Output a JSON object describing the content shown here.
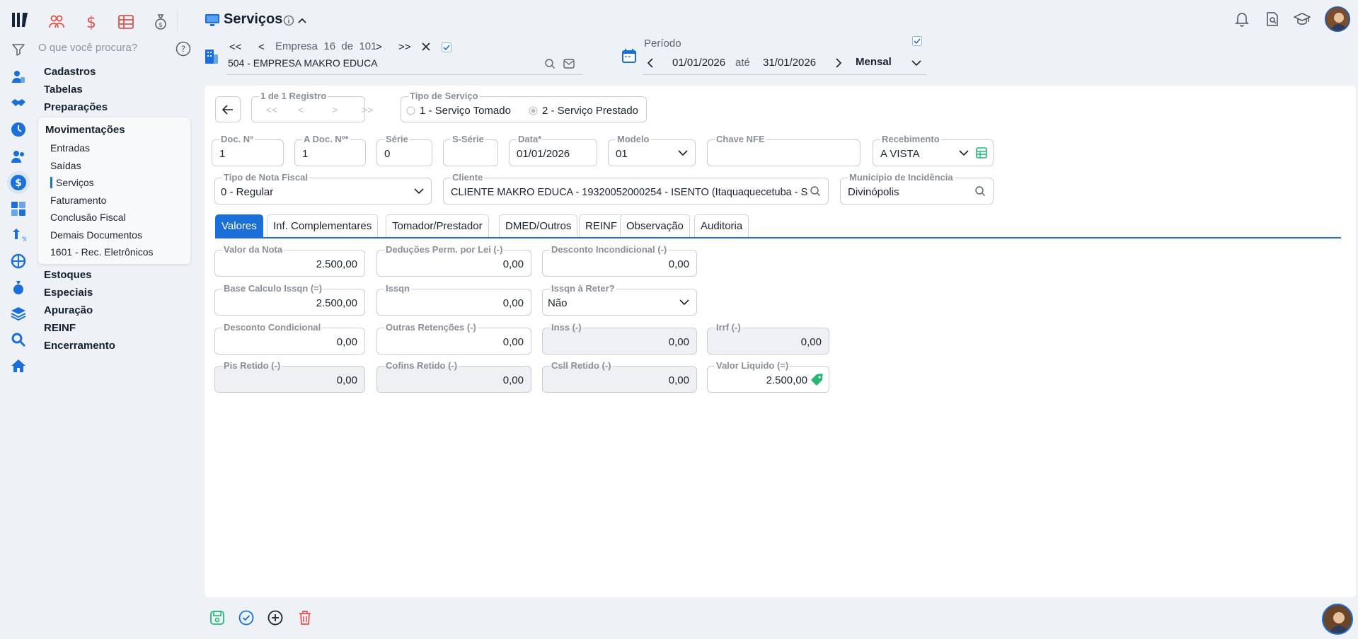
{
  "header": {
    "title": "Serviços",
    "empresa_nav_label": "Empresa",
    "empresa_index": "16",
    "empresa_de": "de",
    "empresa_total": "101",
    "empresa_value": "504 - EMPRESA MAKRO EDUCA",
    "periodo_label": "Período",
    "periodo_start": "01/01/2026",
    "periodo_ate": "até",
    "periodo_end": "31/01/2026",
    "periodo_type": "Mensal"
  },
  "search": {
    "placeholder": "O que você procura?"
  },
  "sidebar": {
    "top_items": [
      "Cadastros",
      "Tabelas",
      "Preparações"
    ],
    "submenu_title": "Movimentações",
    "submenu_items": [
      "Entradas",
      "Saídas",
      "Serviços",
      "Faturamento",
      "Conclusão Fiscal",
      "Demais Documentos",
      "1601 - Rec. Eletrônicos"
    ],
    "bottom_items": [
      "Estoques",
      "Especiais",
      "Apuração",
      "REINF",
      "Encerramento"
    ]
  },
  "record_nav": {
    "label": "1 de 1 Registro"
  },
  "tipo_servico": {
    "label": "Tipo de Serviço",
    "options": [
      "1 - Serviço Tomado",
      "2 - Serviço Prestado"
    ],
    "selected": "2 - Serviço Prestado"
  },
  "doc_fields": {
    "doc_no": {
      "label": "Doc. Nº",
      "value": "1"
    },
    "a_doc_no": {
      "label": "A Doc. Nº*",
      "value": "1"
    },
    "serie": {
      "label": "Série",
      "value": "0"
    },
    "s_serie": {
      "label": "S-Série",
      "value": ""
    },
    "data": {
      "label": "Data*",
      "value": "01/01/2026"
    },
    "modelo": {
      "label": "Modelo",
      "value": "01"
    },
    "chave_nfe": {
      "label": "Chave NFE",
      "value": ""
    },
    "recebimento": {
      "label": "Recebimento",
      "value": "A VISTA"
    },
    "tipo_nota": {
      "label": "Tipo de Nota Fiscal",
      "value": "0 - Regular"
    },
    "cliente": {
      "label": "Cliente",
      "value": "CLIENTE MAKRO EDUCA - 19320052000254 - ISENTO (Itaquaquecetuba - S..."
    },
    "municipio": {
      "label": "Município de Incidência",
      "value": "Divinópolis"
    }
  },
  "tabs": [
    "Valores",
    "Inf. Complementares",
    "Tomador/Prestador",
    "DMED/Outros",
    "REINF",
    "Observação",
    "Auditoria"
  ],
  "valores": {
    "valor_nota": {
      "label": "Valor da Nota",
      "value": "2.500,00"
    },
    "deducoes": {
      "label": "Deduções Perm. por Lei (-)",
      "value": "0,00"
    },
    "desc_incond": {
      "label": "Desconto Incondicional (-)",
      "value": "0,00"
    },
    "base_issqn": {
      "label": "Base Calculo Issqn (=)",
      "value": "2.500,00"
    },
    "issqn": {
      "label": "Issqn",
      "value": "0,00"
    },
    "issqn_reter": {
      "label": "Issqn à Reter?",
      "value": "Não"
    },
    "desc_cond": {
      "label": "Desconto Condicional",
      "value": "0,00"
    },
    "outras_ret": {
      "label": "Outras Retenções (-)",
      "value": "0,00"
    },
    "inss": {
      "label": "Inss (-)",
      "value": "0,00"
    },
    "irrf": {
      "label": "Irrf (-)",
      "value": "0,00"
    },
    "pis": {
      "label": "Pis Retido (-)",
      "value": "0,00"
    },
    "cofins": {
      "label": "Cofins Retido (-)",
      "value": "0,00"
    },
    "csll": {
      "label": "Csll Retido (-)",
      "value": "0,00"
    },
    "valor_liquido": {
      "label": "Valor Liquido (=)",
      "value": "2.500,00"
    }
  },
  "colors": {
    "accent": "#1a6fd8",
    "danger": "#e0524f",
    "success": "#25b873"
  }
}
